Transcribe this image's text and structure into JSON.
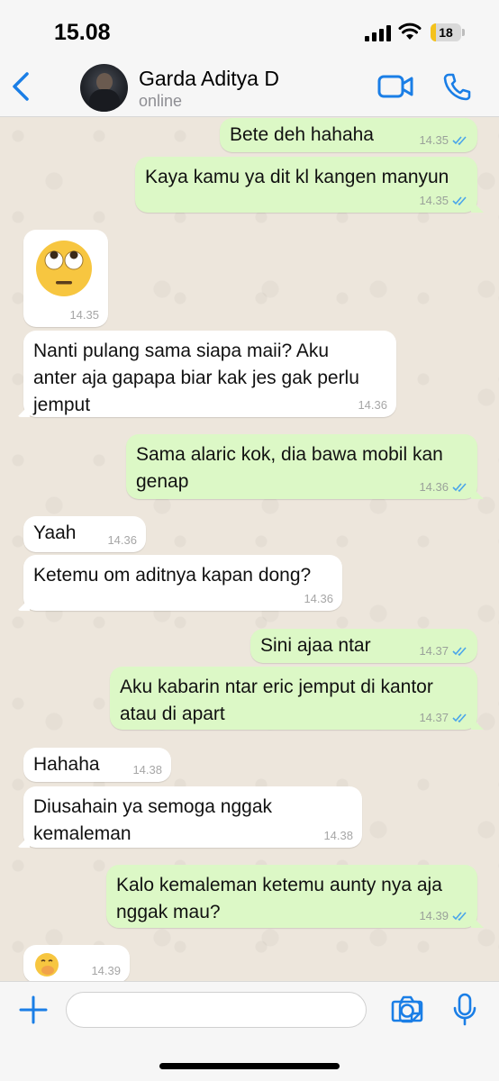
{
  "status_bar": {
    "time": "15.08",
    "battery_percent": 18,
    "battery_label": "18"
  },
  "header": {
    "contact_name": "Garda Aditya D",
    "contact_status": "online"
  },
  "colors": {
    "accent": "#1a7ee6",
    "outgoing_bubble": "#dcf8c6",
    "incoming_bubble": "#ffffff",
    "read_ticks": "#4aa5ea"
  },
  "messages": [
    {
      "dir": "out",
      "text": "Bete deh hahaha",
      "time": "14.35"
    },
    {
      "dir": "out",
      "text": "Kaya kamu ya dit kl kangen manyun",
      "time": "14.35"
    },
    {
      "dir": "in",
      "emoji": "face-with-rolling-eyes",
      "time": "14.35"
    },
    {
      "dir": "in",
      "text": "Nanti pulang sama siapa maii? Aku\nanter aja gapapa biar kak jes gak perlu\njemput",
      "time": "14.36"
    },
    {
      "dir": "out",
      "text": "Sama alaric kok, dia bawa mobil kan\ngenap",
      "time": "14.36"
    },
    {
      "dir": "in",
      "text": "Yaah",
      "time": "14.36"
    },
    {
      "dir": "in",
      "text": "Ketemu om aditnya kapan dong?",
      "time": "14.36"
    },
    {
      "dir": "out",
      "text": "Sini ajaa ntar",
      "time": "14.37"
    },
    {
      "dir": "out",
      "text": "Aku kabarin ntar eric jemput di kantor\natau di apart",
      "time": "14.37"
    },
    {
      "dir": "in",
      "text": "Hahaha",
      "time": "14.38"
    },
    {
      "dir": "in",
      "text": "Diusahain ya semoga nggak\nkemaleman",
      "time": "14.38"
    },
    {
      "dir": "out",
      "text": "Kalo kemaleman ketemu aunty nya aja\nnggak mau?",
      "time": "14.39"
    },
    {
      "dir": "in",
      "emoji": "face-with-hand-over-mouth",
      "time": "14.39"
    }
  ],
  "composer": {
    "placeholder": ""
  }
}
